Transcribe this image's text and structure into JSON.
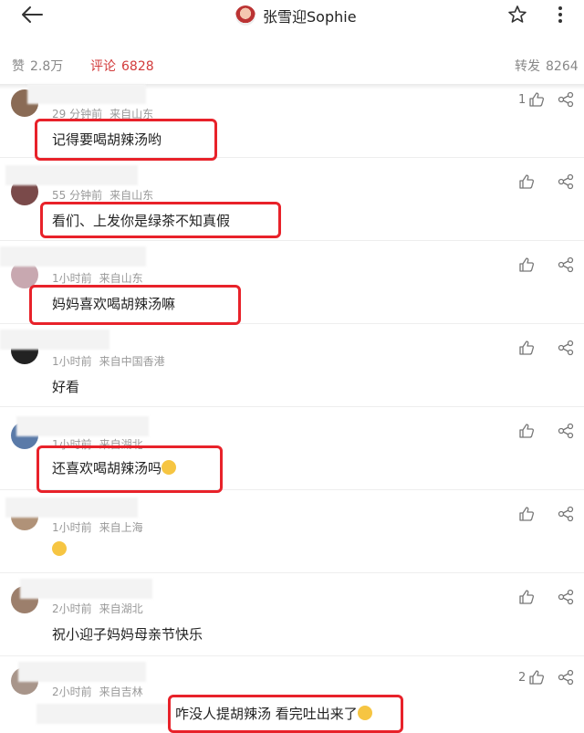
{
  "header": {
    "title": "张雪迎Sophie",
    "icons": [
      "back-arrow-icon",
      "star-icon",
      "more-vertical-icon"
    ]
  },
  "stats": {
    "likes_label": "赞",
    "likes_value": "2.8万",
    "comments_label": "评论",
    "comments_value": "6828",
    "reposts_label": "转发",
    "reposts_value": "8264",
    "active_color": "#d23b3b"
  },
  "comments": [
    {
      "time": "29 分钟前",
      "location": "来自山东",
      "text": "记得要喝胡辣汤哟",
      "likes": "1"
    },
    {
      "time": "55 分钟前",
      "location": "来自山东",
      "text": "看们、上发你是绿茶不知真假",
      "likes": ""
    },
    {
      "time": "1小时前",
      "location": "来自山东",
      "text": "妈妈喜欢喝胡辣汤嘛",
      "likes": ""
    },
    {
      "time": "1小时前",
      "location": "来自中国香港",
      "text": "好看",
      "likes": ""
    },
    {
      "time": "1小时前",
      "location": "来自湖北",
      "text": "还喜欢喝胡辣汤吗",
      "likes": ""
    },
    {
      "time": "1小时前",
      "location": "来自上海",
      "text": "",
      "likes": ""
    },
    {
      "time": "2小时前",
      "location": "来自湖北",
      "text": "祝小迎子妈妈母亲节快乐",
      "likes": ""
    },
    {
      "time": "2小时前",
      "location": "来自吉林",
      "text": "咋没人提胡辣汤 看完吐出来了",
      "likes": "2"
    }
  ],
  "highlight_color": "#e8222a"
}
